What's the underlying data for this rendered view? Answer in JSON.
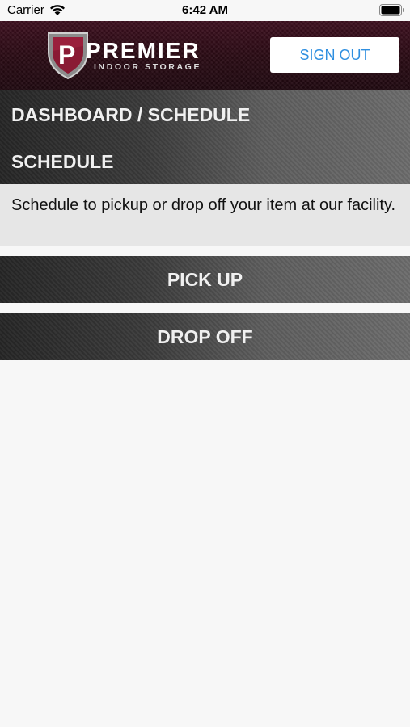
{
  "status_bar": {
    "carrier": "Carrier",
    "time": "6:42 AM"
  },
  "header": {
    "logo_name": "PREMIER",
    "logo_subtitle": "INDOOR STORAGE",
    "sign_out_label": "SIGN OUT",
    "brand_color": "#3d0f1e",
    "link_color": "#2f8fe0"
  },
  "breadcrumb": "DASHBOARD / SCHEDULE",
  "page_title": "SCHEDULE",
  "description": "Schedule to pickup or drop off your item at our facility.",
  "actions": {
    "pickup_label": "PICK UP",
    "dropoff_label": "DROP OFF"
  }
}
